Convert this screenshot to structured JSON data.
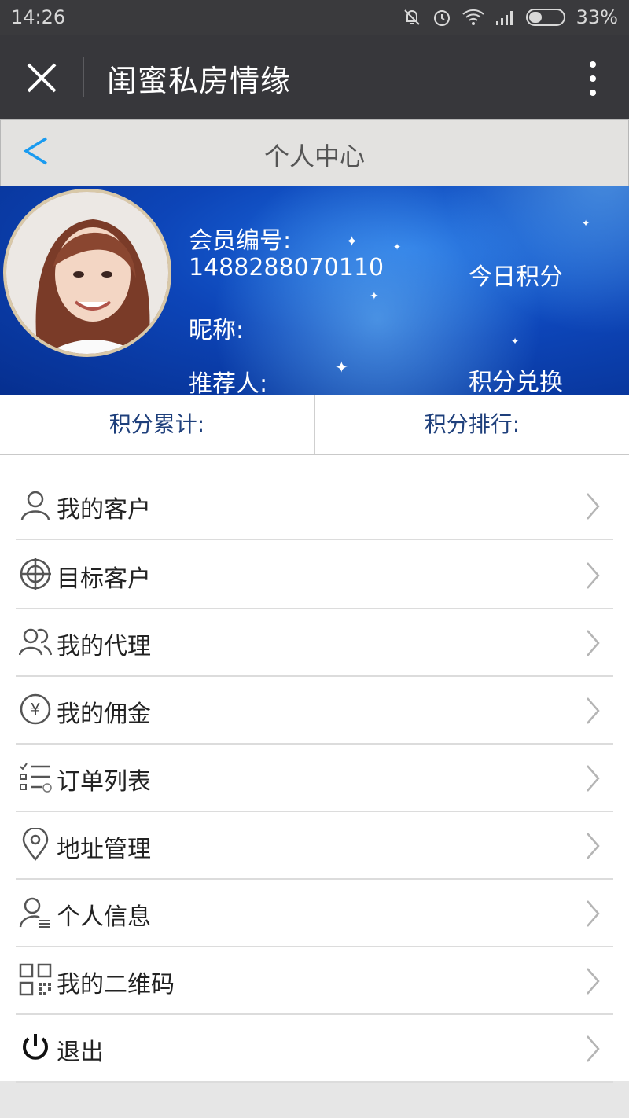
{
  "status_bar": {
    "time": "14:26",
    "battery": "33%"
  },
  "title_bar": {
    "title": "闺蜜私房情缘"
  },
  "nav": {
    "title": "个人中心"
  },
  "profile": {
    "member_label": "会员编号:",
    "member_number": "1488288070110",
    "nickname_label": "昵称:",
    "referrer_label": "推荐人:",
    "today_points": "今日积分",
    "points_exchange": "积分兑换"
  },
  "stats": {
    "total_label": "积分累计:",
    "rank_label": "积分排行:"
  },
  "menu": {
    "items": [
      {
        "label": "我的客户",
        "icon": "user-icon"
      },
      {
        "label": "目标客户",
        "icon": "target-icon"
      },
      {
        "label": "我的代理",
        "icon": "users-icon"
      },
      {
        "label": "我的佣金",
        "icon": "yen-icon"
      },
      {
        "label": "订单列表",
        "icon": "checklist-icon"
      },
      {
        "label": "地址管理",
        "icon": "location-pin-icon"
      },
      {
        "label": "个人信息",
        "icon": "user-card-icon"
      },
      {
        "label": "我的二维码",
        "icon": "qrcode-icon"
      },
      {
        "label": "退出",
        "icon": "power-icon"
      }
    ]
  },
  "colors": {
    "title_bar": "#37373b",
    "banner_blue": "#0d45b8",
    "stats_text": "#1e3f7b",
    "back_arrow": "#1a9bf0"
  }
}
